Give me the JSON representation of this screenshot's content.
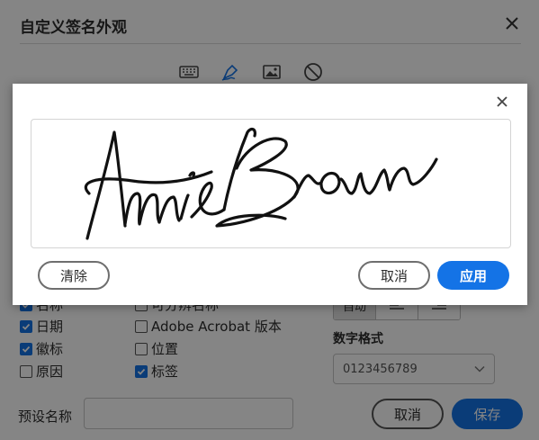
{
  "background_dialog": {
    "title": "自定义签名外观",
    "mode_tabs": [
      {
        "icon": "keyboard-icon"
      },
      {
        "icon": "pen-draw-icon",
        "active": true
      },
      {
        "icon": "image-icon"
      },
      {
        "icon": "none-icon"
      }
    ],
    "options": {
      "name": {
        "label": "名称",
        "checked": true
      },
      "distinguished_name": {
        "label": "可分辨名称",
        "checked": false
      },
      "date": {
        "label": "日期",
        "checked": true
      },
      "adobe_version": {
        "label": "Adobe Acrobat 版本",
        "checked": false
      },
      "logo": {
        "label": "徽标",
        "checked": true
      },
      "location": {
        "label": "位置",
        "checked": false
      },
      "reason": {
        "label": "原因",
        "checked": false
      },
      "labels": {
        "label": "标签",
        "checked": true
      }
    },
    "text_alignment": {
      "options": [
        "自动",
        "left-align-icon",
        "right-align-icon"
      ],
      "selected": "自动"
    },
    "number_format": {
      "label": "数字格式",
      "value": "0123456789"
    },
    "preset_name": {
      "label": "预设名称",
      "value": ""
    },
    "cancel_label": "取消",
    "save_label": "保存"
  },
  "draw_modal": {
    "signature_text": "Annie Brown",
    "clear_label": "清除",
    "cancel_label": "取消",
    "apply_label": "应用"
  },
  "colors": {
    "accent": "#1473e6",
    "overlay": "rgba(0,0,0,0.48)"
  }
}
